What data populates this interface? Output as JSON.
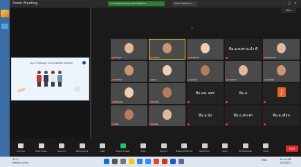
{
  "window": {
    "title": "Zoom Meeting",
    "banner": "Yuu Phatkhumnong  กำลังแชร์หน้าจอ",
    "banner_secondary": "View Options ▾",
    "view_label": "View"
  },
  "controls": [
    {
      "label": "Unmute",
      "icon": "microphone-muted-icon"
    },
    {
      "label": "Start Video",
      "icon": "video-off-icon"
    },
    {
      "label": "Security",
      "icon": "shield-icon"
    },
    {
      "label": "Participants",
      "icon": "participants-icon"
    },
    {
      "label": "Chat",
      "icon": "chat-icon"
    },
    {
      "label": "Share Screen",
      "icon": "share-screen-icon"
    },
    {
      "label": "Polls",
      "icon": "polls-icon"
    },
    {
      "label": "Record",
      "icon": "record-icon"
    },
    {
      "label": "Breakout Rooms",
      "icon": "breakout-rooms-icon"
    },
    {
      "label": "Reactions",
      "icon": "reactions-icon"
    },
    {
      "label": "Apps",
      "icon": "apps-icon"
    },
    {
      "label": "Whiteboards",
      "icon": "whiteboard-icon"
    },
    {
      "label": "More",
      "icon": "more-icon"
    }
  ],
  "end_button": "End",
  "shared_slide": {
    "title": "Lg.A Ontology Consultation Session"
  },
  "participants": [
    {
      "name": "Phichaya",
      "type": "video"
    },
    {
      "name": "Koraphat",
      "type": "video"
    },
    {
      "name": "Thanaporn",
      "type": "video"
    },
    {
      "name": "ทีม.ฉ.ตะพาน.นำ.ที",
      "type": "name"
    },
    {
      "name": "Teerapong",
      "type": "video"
    },
    {
      "name": "Kanokwan",
      "type": "video"
    },
    {
      "name": "Napat",
      "type": "video"
    },
    {
      "name": "Supanee",
      "type": "video"
    },
    {
      "name": "Pornpimol",
      "type": "video"
    },
    {
      "name": "Saowalak",
      "type": "video"
    },
    {
      "name": "Wiphawan",
      "type": "video"
    },
    {
      "name": "Chanida",
      "type": "video"
    },
    {
      "name": "ทีม.คน. ศสร",
      "type": "name"
    },
    {
      "name": "ทีม.ฉ",
      "type": "name"
    },
    {
      "name": "J",
      "type": "avatar"
    },
    {
      "name": "Sirirat",
      "type": "video"
    },
    {
      "name": "Atchara",
      "type": "video"
    },
    {
      "name": "ทีม.ฉ.นั่ง",
      "type": "name"
    },
    {
      "name": "ทีม.ฉ.พระพร",
      "type": "name"
    },
    {
      "name": "ทีม.ฉ.เดือน",
      "type": "name"
    }
  ],
  "taskbar": {
    "weather_temp": "33°C",
    "weather_desc": "Mostly sunny",
    "tray": "ENG",
    "time": "10:44 AM",
    "date": "4/1/2022"
  }
}
